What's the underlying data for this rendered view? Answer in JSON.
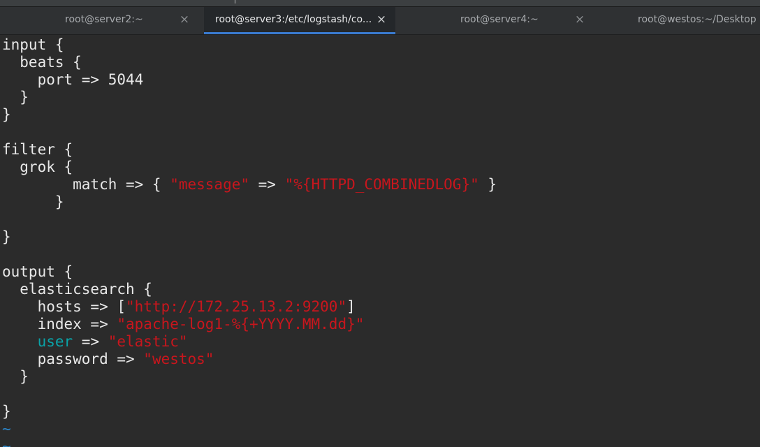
{
  "tabs": [
    {
      "title": "root@server2:~",
      "close": "×",
      "active": false
    },
    {
      "title": "root@server3:/etc/logstash/co...",
      "close": "×",
      "active": true
    },
    {
      "title": "root@server4:~",
      "close": "×",
      "active": false
    },
    {
      "title": "root@westos:~/Desktop",
      "active": false
    }
  ],
  "colors": {
    "background": "#2b2b2b",
    "text": "#e8e8e8",
    "string": "#c8161d",
    "keyword": "#0aa3a8",
    "tilde": "#2c86c9",
    "active_tab_indicator": "#3a7bd0"
  },
  "editor": {
    "lines": [
      [
        {
          "t": "input {"
        }
      ],
      [
        {
          "t": "  beats {"
        }
      ],
      [
        {
          "t": "    port => 5044"
        }
      ],
      [
        {
          "t": "  }"
        }
      ],
      [
        {
          "t": "}"
        }
      ],
      [],
      [
        {
          "t": "filter {"
        }
      ],
      [
        {
          "t": "  grok {"
        }
      ],
      [
        {
          "t": "        match => { "
        },
        {
          "t": "\"message\"",
          "c": "str"
        },
        {
          "t": " => "
        },
        {
          "t": "\"%{HTTPD_COMBINEDLOG}\"",
          "c": "str"
        },
        {
          "t": " }"
        }
      ],
      [
        {
          "t": "      }"
        }
      ],
      [],
      [
        {
          "t": "}"
        }
      ],
      [],
      [
        {
          "t": "output {"
        }
      ],
      [
        {
          "t": "  elasticsearch {"
        }
      ],
      [
        {
          "t": "    hosts => ["
        },
        {
          "t": "\"http://172.25.13.2:9200\"",
          "c": "str"
        },
        {
          "t": "]"
        }
      ],
      [
        {
          "t": "    index => "
        },
        {
          "t": "\"apache-log1-%{+YYYY.MM.dd}\"",
          "c": "str"
        }
      ],
      [
        {
          "t": "    "
        },
        {
          "t": "user",
          "c": "key"
        },
        {
          "t": " => "
        },
        {
          "t": "\"elastic\"",
          "c": "str"
        }
      ],
      [
        {
          "t": "    password => "
        },
        {
          "t": "\"westos\"",
          "c": "str"
        }
      ],
      [
        {
          "t": "  }"
        }
      ],
      [],
      [
        {
          "t": "}"
        }
      ],
      [
        {
          "t": "~",
          "c": "tilde"
        }
      ],
      [
        {
          "t": "~",
          "c": "tilde"
        }
      ]
    ]
  }
}
